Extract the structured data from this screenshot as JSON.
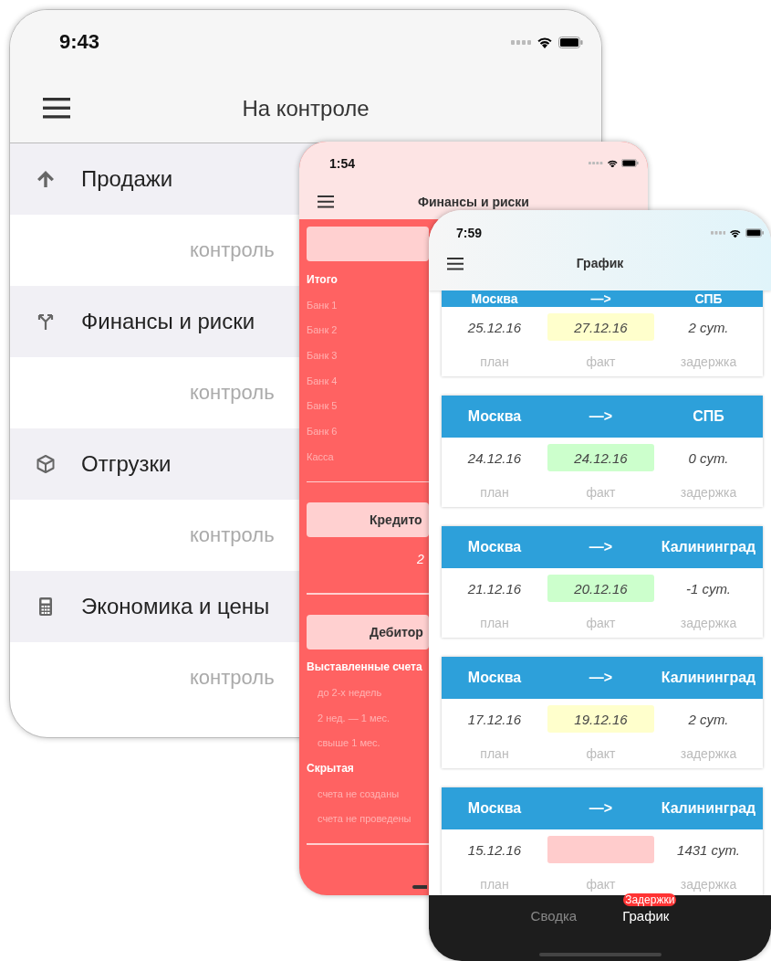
{
  "main_screen": {
    "status_time": "9:43",
    "title": "На контроле",
    "sections": [
      {
        "label": "Продажи",
        "subtitle": "контроль"
      },
      {
        "label": "Финансы и риски",
        "subtitle": "контроль"
      },
      {
        "label": "Отгрузки",
        "subtitle": "контроль"
      },
      {
        "label": "Экономика и цены",
        "subtitle": "контроль"
      }
    ]
  },
  "finance_screen": {
    "status_time": "1:54",
    "title": "Финансы и риски",
    "blocks": [
      {
        "rows": [
          {
            "kind": "total",
            "label": "Итого"
          },
          {
            "kind": "item",
            "label": "Банк 1"
          },
          {
            "kind": "item",
            "label": "Банк 2"
          },
          {
            "kind": "item",
            "label": "Банк 3"
          },
          {
            "kind": "item",
            "label": "Банк 4"
          },
          {
            "kind": "item",
            "label": "Банк 5"
          },
          {
            "kind": "item",
            "label": "Банк 6"
          },
          {
            "kind": "item",
            "label": "Касса"
          }
        ]
      },
      {
        "button": "Кредито",
        "value": "2"
      },
      {
        "button": "Дебитор",
        "groups": [
          {
            "label": "Выставленные счета",
            "children": [
              {
                "label": "до 2-х недель"
              },
              {
                "label": "2 нед. — 1 мес."
              },
              {
                "label": "свыше 1 мес."
              }
            ]
          },
          {
            "label": "Скрытая",
            "children": [
              {
                "label": "счета не созданы"
              },
              {
                "label": "счета не проведены"
              }
            ]
          }
        ]
      }
    ]
  },
  "schedule_screen": {
    "status_time": "7:59",
    "title": "График",
    "shipments": [
      {
        "from": "Москва",
        "arrow": "—>",
        "to": "СПБ",
        "plan": "25.12.16",
        "fact": "27.12.16",
        "color": "#ffffcc",
        "delay": "2 сут.",
        "plan_label": "план",
        "fact_label": "факт",
        "delay_label": "задержка"
      },
      {
        "from": "Москва",
        "arrow": "—>",
        "to": "СПБ",
        "plan": "24.12.16",
        "fact": "24.12.16",
        "color": "#ccffcc",
        "delay": "0 сут.",
        "plan_label": "план",
        "fact_label": "факт",
        "delay_label": "задержка"
      },
      {
        "from": "Москва",
        "arrow": "—>",
        "to": "Калининград",
        "plan": "21.12.16",
        "fact": "20.12.16",
        "color": "#ccffcc",
        "delay": "-1 сут.",
        "plan_label": "план",
        "fact_label": "факт",
        "delay_label": "задержка"
      },
      {
        "from": "Москва",
        "arrow": "—>",
        "to": "Калининград",
        "plan": "17.12.16",
        "fact": "19.12.16",
        "color": "#ffffcc",
        "delay": "2 сут.",
        "plan_label": "план",
        "fact_label": "факт",
        "delay_label": "задержка"
      },
      {
        "from": "Москва",
        "arrow": "—>",
        "to": "Калининград",
        "plan": "15.12.16",
        "color": "#ffcccc",
        "delay": "1431 сут.",
        "plan_label": "план",
        "fact_label": "факт",
        "delay_label": "задержка"
      }
    ],
    "tabs": [
      {
        "label": "Сводка",
        "selected": false
      },
      {
        "label": "График",
        "selected": true,
        "badge": "Задержки"
      }
    ]
  }
}
